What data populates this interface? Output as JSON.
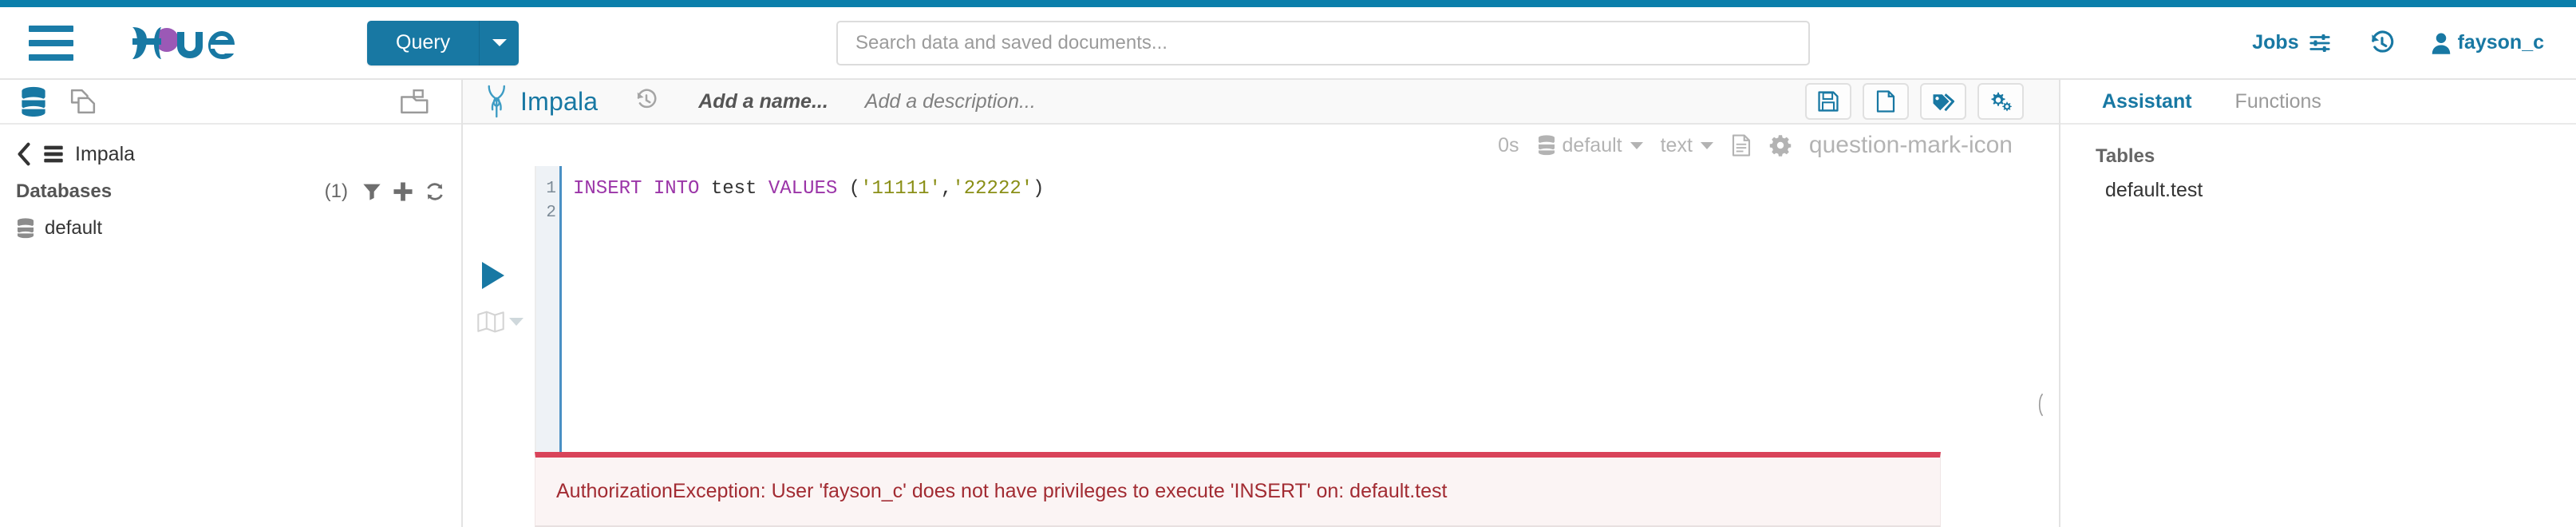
{
  "theme": {
    "accent_blue": "#0B7FAB",
    "link_blue": "#1878A3",
    "error_red": "#d9435a",
    "error_text": "#a22b32",
    "sql_keyword": "#9b35a8",
    "sql_string": "#8a8f17"
  },
  "navbar": {
    "menu_icon": "hamburger-icon",
    "logo_text": "hue",
    "query_button": "Query",
    "query_caret_icon": "chevron-down-icon",
    "search": {
      "placeholder": "Search data and saved documents...",
      "value": "",
      "icon": "search-icon"
    },
    "jobs_label": "Jobs",
    "jobs_icon": "sliders-icon",
    "history_icon": "history-icon",
    "user_icon": "user-icon",
    "username": "fayson_c"
  },
  "left_panel": {
    "toolbar": {
      "database_icon": "database-stack-icon",
      "documents_icon": "documents-icon",
      "open_folder_icon": "open-folder-icon"
    },
    "breadcrumb": {
      "back_icon": "chevron-left-icon",
      "source_icon": "server-icon",
      "source_label": "Impala"
    },
    "databases": {
      "title": "Databases",
      "count": "(1)",
      "filter_icon": "funnel-icon",
      "add_icon": "plus-icon",
      "refresh_icon": "refresh-icon",
      "items": [
        {
          "icon": "database-icon",
          "label": "default"
        }
      ]
    }
  },
  "editor": {
    "header": {
      "engine_icon": "impala-logo-icon",
      "engine_label": "Impala",
      "history_icon": "history-icon",
      "name_placeholder": "Add a name...",
      "description_placeholder": "Add a description...",
      "buttons": [
        {
          "name": "save-button",
          "icon": "floppy-disk-icon"
        },
        {
          "name": "new-document-button",
          "icon": "file-icon"
        },
        {
          "name": "tags-button",
          "icon": "tags-icon"
        },
        {
          "name": "settings-button",
          "icon": "gears-icon"
        }
      ]
    },
    "subbar": {
      "duration": "0s",
      "database_icon": "database-icon",
      "database": "default",
      "format": "text",
      "result_icon": "file-text-icon",
      "settings_icon": "gear-icon",
      "help_icon": "question-mark-icon"
    },
    "run_button_icon": "play-icon",
    "map_button_icon": "map-icon",
    "map_caret_icon": "caret-down-icon",
    "gutter": [
      "1",
      "2"
    ],
    "code_tokens": [
      {
        "text": "INSERT INTO",
        "type": "kw"
      },
      {
        "text": " ",
        "type": "plain"
      },
      {
        "text": "test",
        "type": "plain"
      },
      {
        "text": " ",
        "type": "plain"
      },
      {
        "text": "VALUES",
        "type": "kw"
      },
      {
        "text": " (",
        "type": "punc"
      },
      {
        "text": "'11111'",
        "type": "str"
      },
      {
        "text": ",",
        "type": "punc"
      },
      {
        "text": "'22222'",
        "type": "str"
      },
      {
        "text": ")",
        "type": "punc"
      }
    ],
    "code_plain": "INSERT INTO test VALUES ('11111','22222')",
    "resize_handle_icon": "resize-handle-icon"
  },
  "error": {
    "message": "AuthorizationException: User 'fayson_c' does not have privileges to execute 'INSERT' on: default.test"
  },
  "right_panel": {
    "tabs": [
      {
        "label": "Assistant",
        "active": true
      },
      {
        "label": "Functions",
        "active": false
      }
    ],
    "tables_title": "Tables",
    "tables": [
      {
        "label": "default.test"
      }
    ]
  }
}
